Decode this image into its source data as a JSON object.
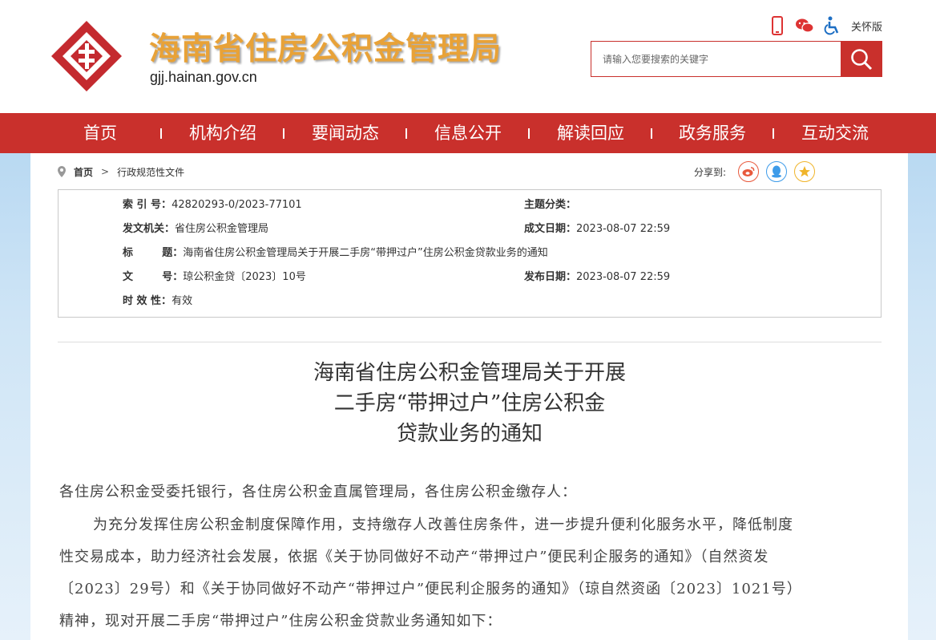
{
  "header": {
    "site_title": "海南省住房公积金管理局",
    "domain": "gjj.hainan.gov.cn",
    "care_mode_label": "关怀版",
    "search_placeholder": "请输入您要搜索的关键字",
    "icons": [
      "mobile-icon",
      "wechat-icon",
      "accessibility-icon",
      "search-icon"
    ],
    "brand_color": "#c9302c",
    "title_color": "#e8a238"
  },
  "nav": {
    "items": [
      "首页",
      "机构介绍",
      "要闻动态",
      "信息公开",
      "解读回应",
      "政务服务",
      "互动交流"
    ]
  },
  "breadcrumb": {
    "home": "首页",
    "separator": ">",
    "current": "行政规范性文件"
  },
  "share": {
    "label": "分享到:",
    "icons": [
      "weibo-icon",
      "qq-icon",
      "qzone-icon"
    ]
  },
  "info": {
    "index_label": "索  引  号：",
    "index_value": "42820293-0/2023-77101",
    "topic_label": "主题分类：",
    "topic_value": "",
    "issuer_label": "发文机关：",
    "issuer_value": "省住房公积金管理局",
    "written_label": "成文日期：",
    "written_value": "2023-08-07 22:59",
    "title_label": "标        题：",
    "title_value": "海南省住房公积金管理局关于开展二手房“带押过户”住房公积金贷款业务的通知",
    "docno_label": "文        号：",
    "docno_value": "琼公积金贷〔2023〕10号",
    "published_label": "发布日期：",
    "published_value": "2023-08-07 22:59",
    "validity_label": "时  效  性：",
    "validity_value": "有效"
  },
  "article": {
    "title_line1": "海南省住房公积金管理局关于开展",
    "title_line2": "二手房“带押过户”住房公积金",
    "title_line3": "贷款业务的通知",
    "greeting": "各住房公积金受委托银行，各住房公积金直属管理局，各住房公积金缴存人：",
    "line1": "为充分发挥住房公积金制度保障作用，支持缴存人改善住房条件，进一步提升便利化服务水平，降低制度",
    "line2": "性交易成本，助力经济社会发展，依据《关于协同做好不动产“带押过户”便民利企服务的通知》（自然资发",
    "line3": "〔2023〕29号）和《关于协同做好不动产“带押过户”便民利企服务的通知》（琼自然资函〔2023〕1021号）",
    "line4": "精神，现对开展二手房“带押过户”住房公积金贷款业务通知如下："
  }
}
